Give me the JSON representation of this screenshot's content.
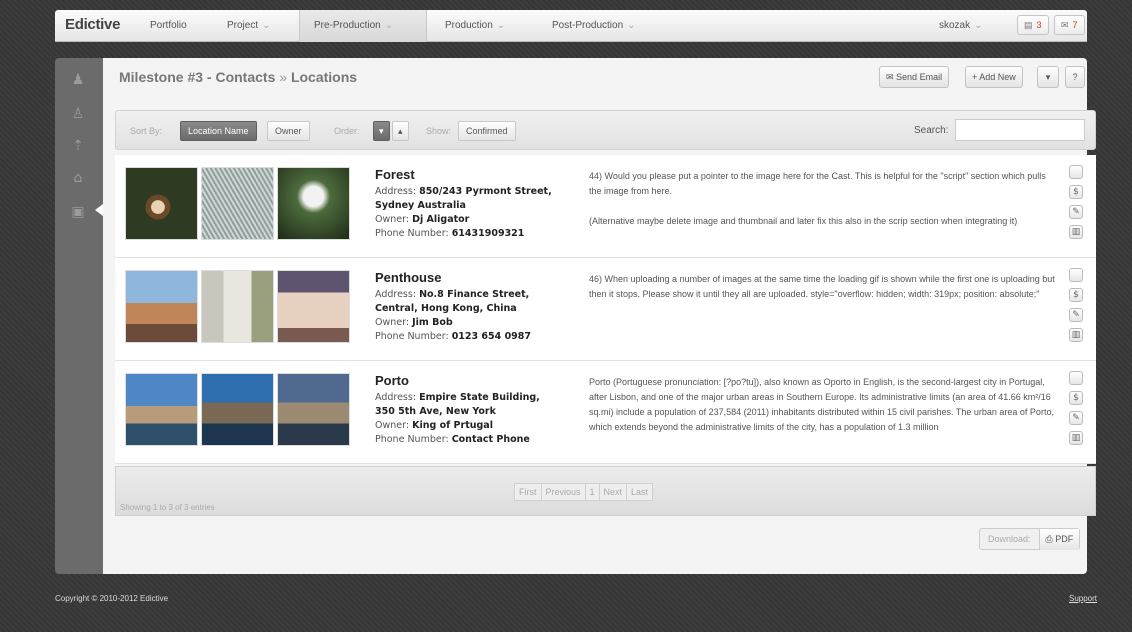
{
  "brand": "Edictive",
  "nav": {
    "items": [
      "Portfolio",
      "Project",
      "Pre-Production",
      "Production",
      "Post-Production"
    ],
    "caret": "⌄"
  },
  "user": {
    "name": "skozak",
    "caret": "⌄"
  },
  "badges": {
    "messages": "3",
    "comments": "7"
  },
  "sidebar": {
    "icons": [
      "user-icon",
      "group-icon",
      "tree-icon",
      "home-icon",
      "briefcase-icon"
    ]
  },
  "header": {
    "title": "Milestone #3 - Contacts",
    "sep": "»",
    "subtitle": "Locations",
    "send_email": "Send Email",
    "add_new": "Add New",
    "help": "?"
  },
  "filters": {
    "sort_by": "Sort By:",
    "sort_location": "Location Name",
    "sort_owner": "Owner",
    "order": "Order:",
    "show": "Show:",
    "confirmed": "Confirmed",
    "search_label": "Search:"
  },
  "labels": {
    "address": "Address:",
    "owner": "Owner:",
    "phone": "Phone Number:"
  },
  "rows": [
    {
      "name": "Forest",
      "addr1": "850/243 Pyrmont Street,",
      "addr2": "Sydney Australia",
      "owner": "Dj Aligator",
      "phone": "61431909321",
      "note": "44) Would you please put a pointer to the image here for the Cast. This is helpful for the \"script\" section which pulls the image from here.",
      "note2": "(Alternative maybe delete image and thumbnail and later fix this also in the scrip section when integrating it)"
    },
    {
      "name": "Penthouse",
      "addr1": "No.8 Finance Street,",
      "addr2": "Central, Hong Kong, China",
      "owner": "Jim Bob",
      "phone": "0123 654 0987",
      "note": "46) When uploading a number of images at the same time the loading gif is shown while the first one is uploading but then it stops. Please show it until they all are uploaded. style=\"overflow: hidden; width: 319px; position: absolute;\"",
      "note2": ""
    },
    {
      "name": "Porto",
      "addr1": "Empire State Building,",
      "addr2": "350 5th Ave, New York",
      "owner": "King of Prtugal",
      "phone": "Contact Phone",
      "note": "Porto (Portuguese pronunciation: [?po?tu]), also known as Oporto in English, is the second-largest city in Portugal, after Lisbon, and one of the major urban areas in Southern Europe. Its administrative limits (an area of 41.66 km²/16 sq.mi) include a population of 237,584 (2011) inhabitants distributed within 15 civil parishes. The urban area of Porto, which extends beyond the administrative limits of the city, has a population of 1.3 million",
      "note2": ""
    }
  ],
  "pager": {
    "first": "First",
    "previous": "Previous",
    "page": "1",
    "next": "Next",
    "last": "Last",
    "showing": "Showing 1 to 3 of 3 entries"
  },
  "download": {
    "label": "Download:",
    "pdf": "PDF"
  },
  "footer": {
    "copyright": "Copyright © 2010-2012 Edictive",
    "support": "Support"
  }
}
